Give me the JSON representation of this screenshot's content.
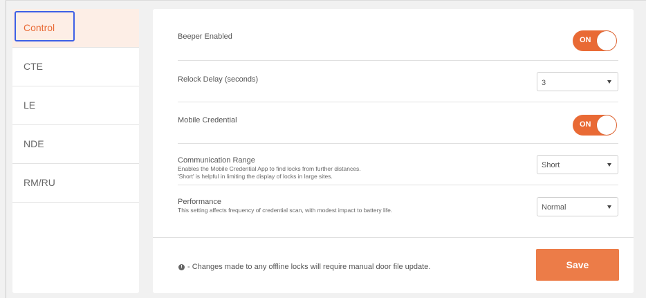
{
  "sidebar": {
    "items": [
      {
        "label": "Control",
        "active": true
      },
      {
        "label": "CTE",
        "active": false
      },
      {
        "label": "LE",
        "active": false
      },
      {
        "label": "NDE",
        "active": false
      },
      {
        "label": "RM/RU",
        "active": false
      }
    ]
  },
  "settings": {
    "beeper": {
      "label": "Beeper Enabled",
      "toggle_text": "ON",
      "enabled": true
    },
    "relock": {
      "label": "Relock Delay (seconds)",
      "value": "3"
    },
    "mobile": {
      "label": "Mobile Credential",
      "toggle_text": "ON",
      "enabled": true
    },
    "range": {
      "label": "Communication Range",
      "desc1": "Enables the Mobile Credential App to find locks from further distances.",
      "desc2": "'Short' is helpful in limiting the display of locks in large sites.",
      "value": "Short"
    },
    "performance": {
      "label": "Performance",
      "desc": "This setting affects frequency of credential scan, with modest impact to battery life.",
      "value": "Normal"
    }
  },
  "footer": {
    "info_icon": "!",
    "note": "- Changes made to any offline locks will require manual door file update.",
    "save_label": "Save"
  },
  "colors": {
    "accent": "#e96a35",
    "save": "#ec7c48",
    "active_bg": "#fdeee6",
    "focus_outline": "#3d5fe6"
  }
}
